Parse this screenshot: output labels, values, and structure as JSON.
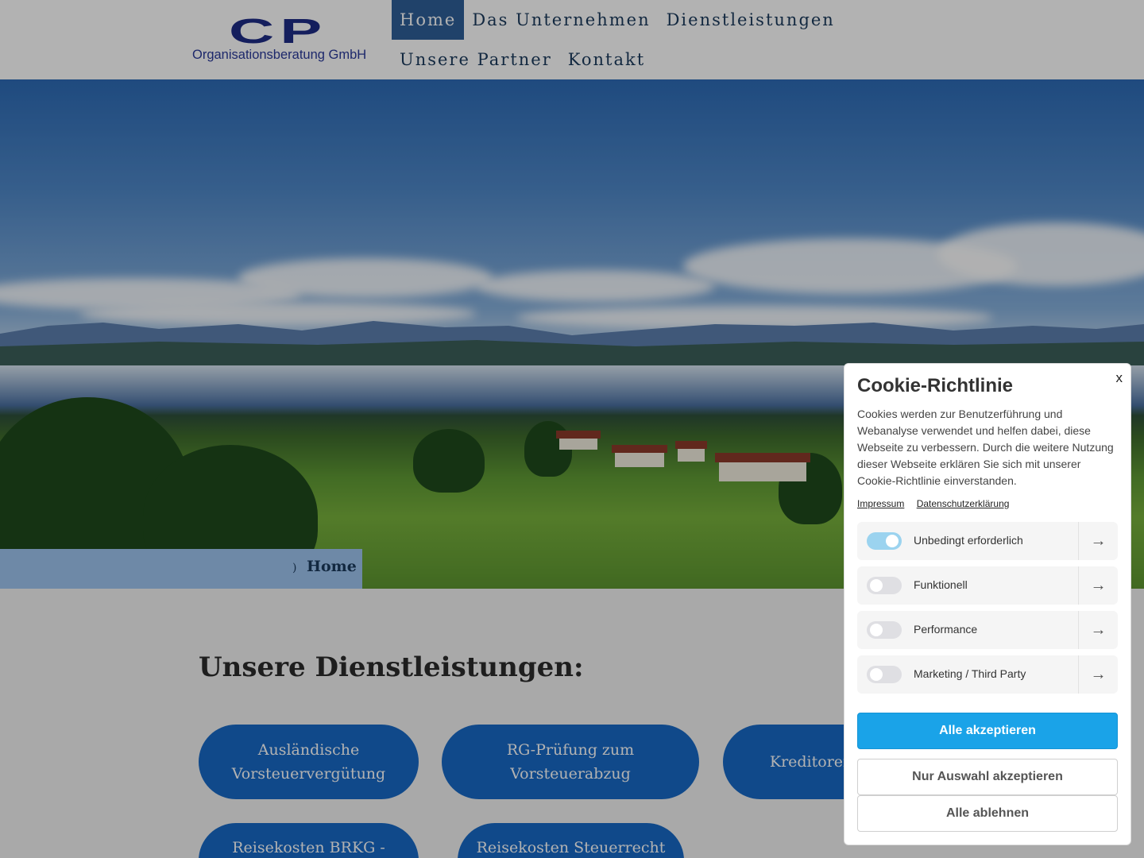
{
  "header": {
    "logo_cp": "CP",
    "logo_subtitle": "Organisationsberatung GmbH",
    "nav": [
      {
        "label": "Home",
        "active": true
      },
      {
        "label": "Das Unternehmen",
        "active": false
      },
      {
        "label": "Dienstleistungen",
        "active": false
      },
      {
        "label": "Unsere Partner",
        "active": false
      },
      {
        "label": "Kontakt",
        "active": false
      }
    ]
  },
  "breadcrumb": {
    "separator": ")",
    "current": "Home"
  },
  "content": {
    "section_title": "Unsere Dienstleistungen:",
    "services": [
      "Ausländische Vorsteuervergütung",
      "RG-Prüfung zum Vorsteuerabzug",
      "Kreditoren Debito",
      "Reisekosten BRKG -",
      "Reisekosten Steuerrecht"
    ]
  },
  "cookie": {
    "close": "x",
    "title": "Cookie-Richtlinie",
    "text": "Cookies werden zur Benutzerführung und Webanalyse verwendet und helfen dabei, diese Webseite zu verbessern. Durch die weitere Nutzung dieser Webseite erklären Sie sich mit unserer Cookie-Richtlinie einverstanden.",
    "links": [
      "Impressum",
      "Datenschutzerklärung"
    ],
    "categories": [
      {
        "label": "Unbedingt erforderlich",
        "enabled": true
      },
      {
        "label": "Funktionell",
        "enabled": false
      },
      {
        "label": "Performance",
        "enabled": false
      },
      {
        "label": "Marketing / Third Party",
        "enabled": false
      }
    ],
    "buttons": {
      "accept_all": "Alle akzeptieren",
      "accept_selection": "Nur Auswahl akzeptieren",
      "reject_all": "Alle ablehnen"
    },
    "colors": {
      "primary": "#1aa3e8",
      "toggle_on": "#9bd3ef",
      "toggle_off": "#dfdfe3"
    }
  }
}
